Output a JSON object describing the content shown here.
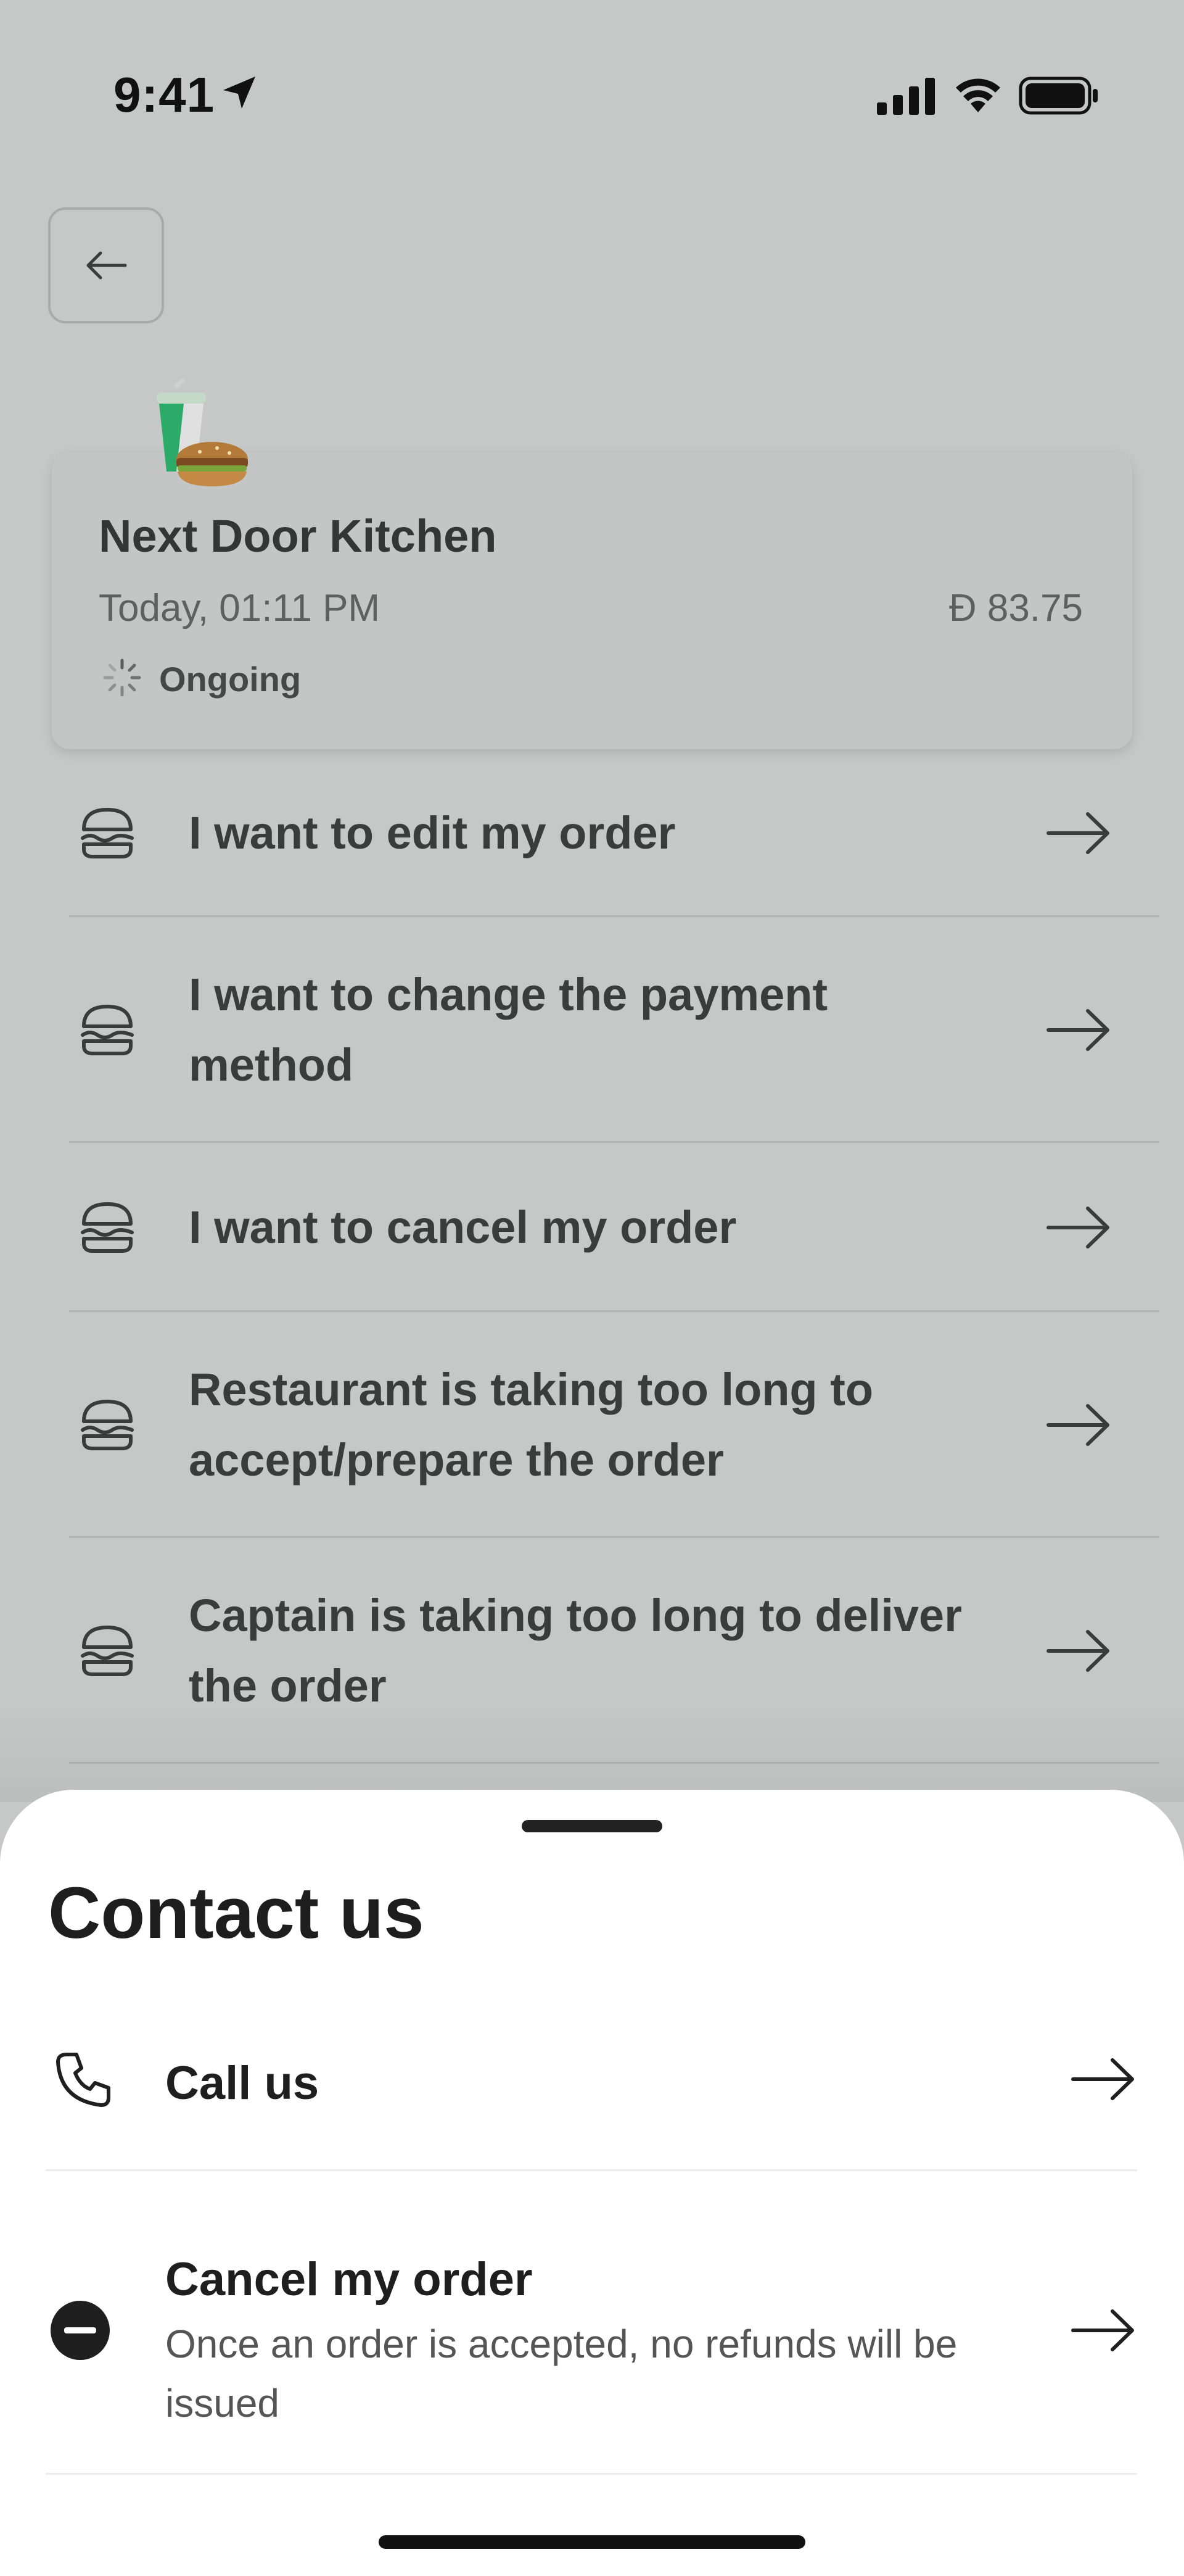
{
  "status_bar": {
    "time": "9:41"
  },
  "order": {
    "restaurant": "Next Door Kitchen",
    "date": "Today, 01:11 PM",
    "price": "Đ 83.75",
    "status": "Ongoing"
  },
  "help_options": [
    {
      "label": "I want to edit my order"
    },
    {
      "label": "I want to change the payment method"
    },
    {
      "label": "I want to cancel my order"
    },
    {
      "label": "Restaurant is taking too long to accept/prepare the order"
    },
    {
      "label": "Captain is taking too long to deliver the order"
    }
  ],
  "contact_sheet": {
    "title": "Contact us",
    "call": {
      "label": "Call us"
    },
    "cancel": {
      "label": "Cancel my order",
      "description": "Once an order is accepted, no refunds will be issued"
    }
  },
  "icons": {
    "back": "arrow-left-icon",
    "help_item": "burger-icon",
    "row_arrow": "arrow-right-icon",
    "call": "phone-icon",
    "cancel": "minus-circle-icon",
    "status": "spinner-icon"
  }
}
